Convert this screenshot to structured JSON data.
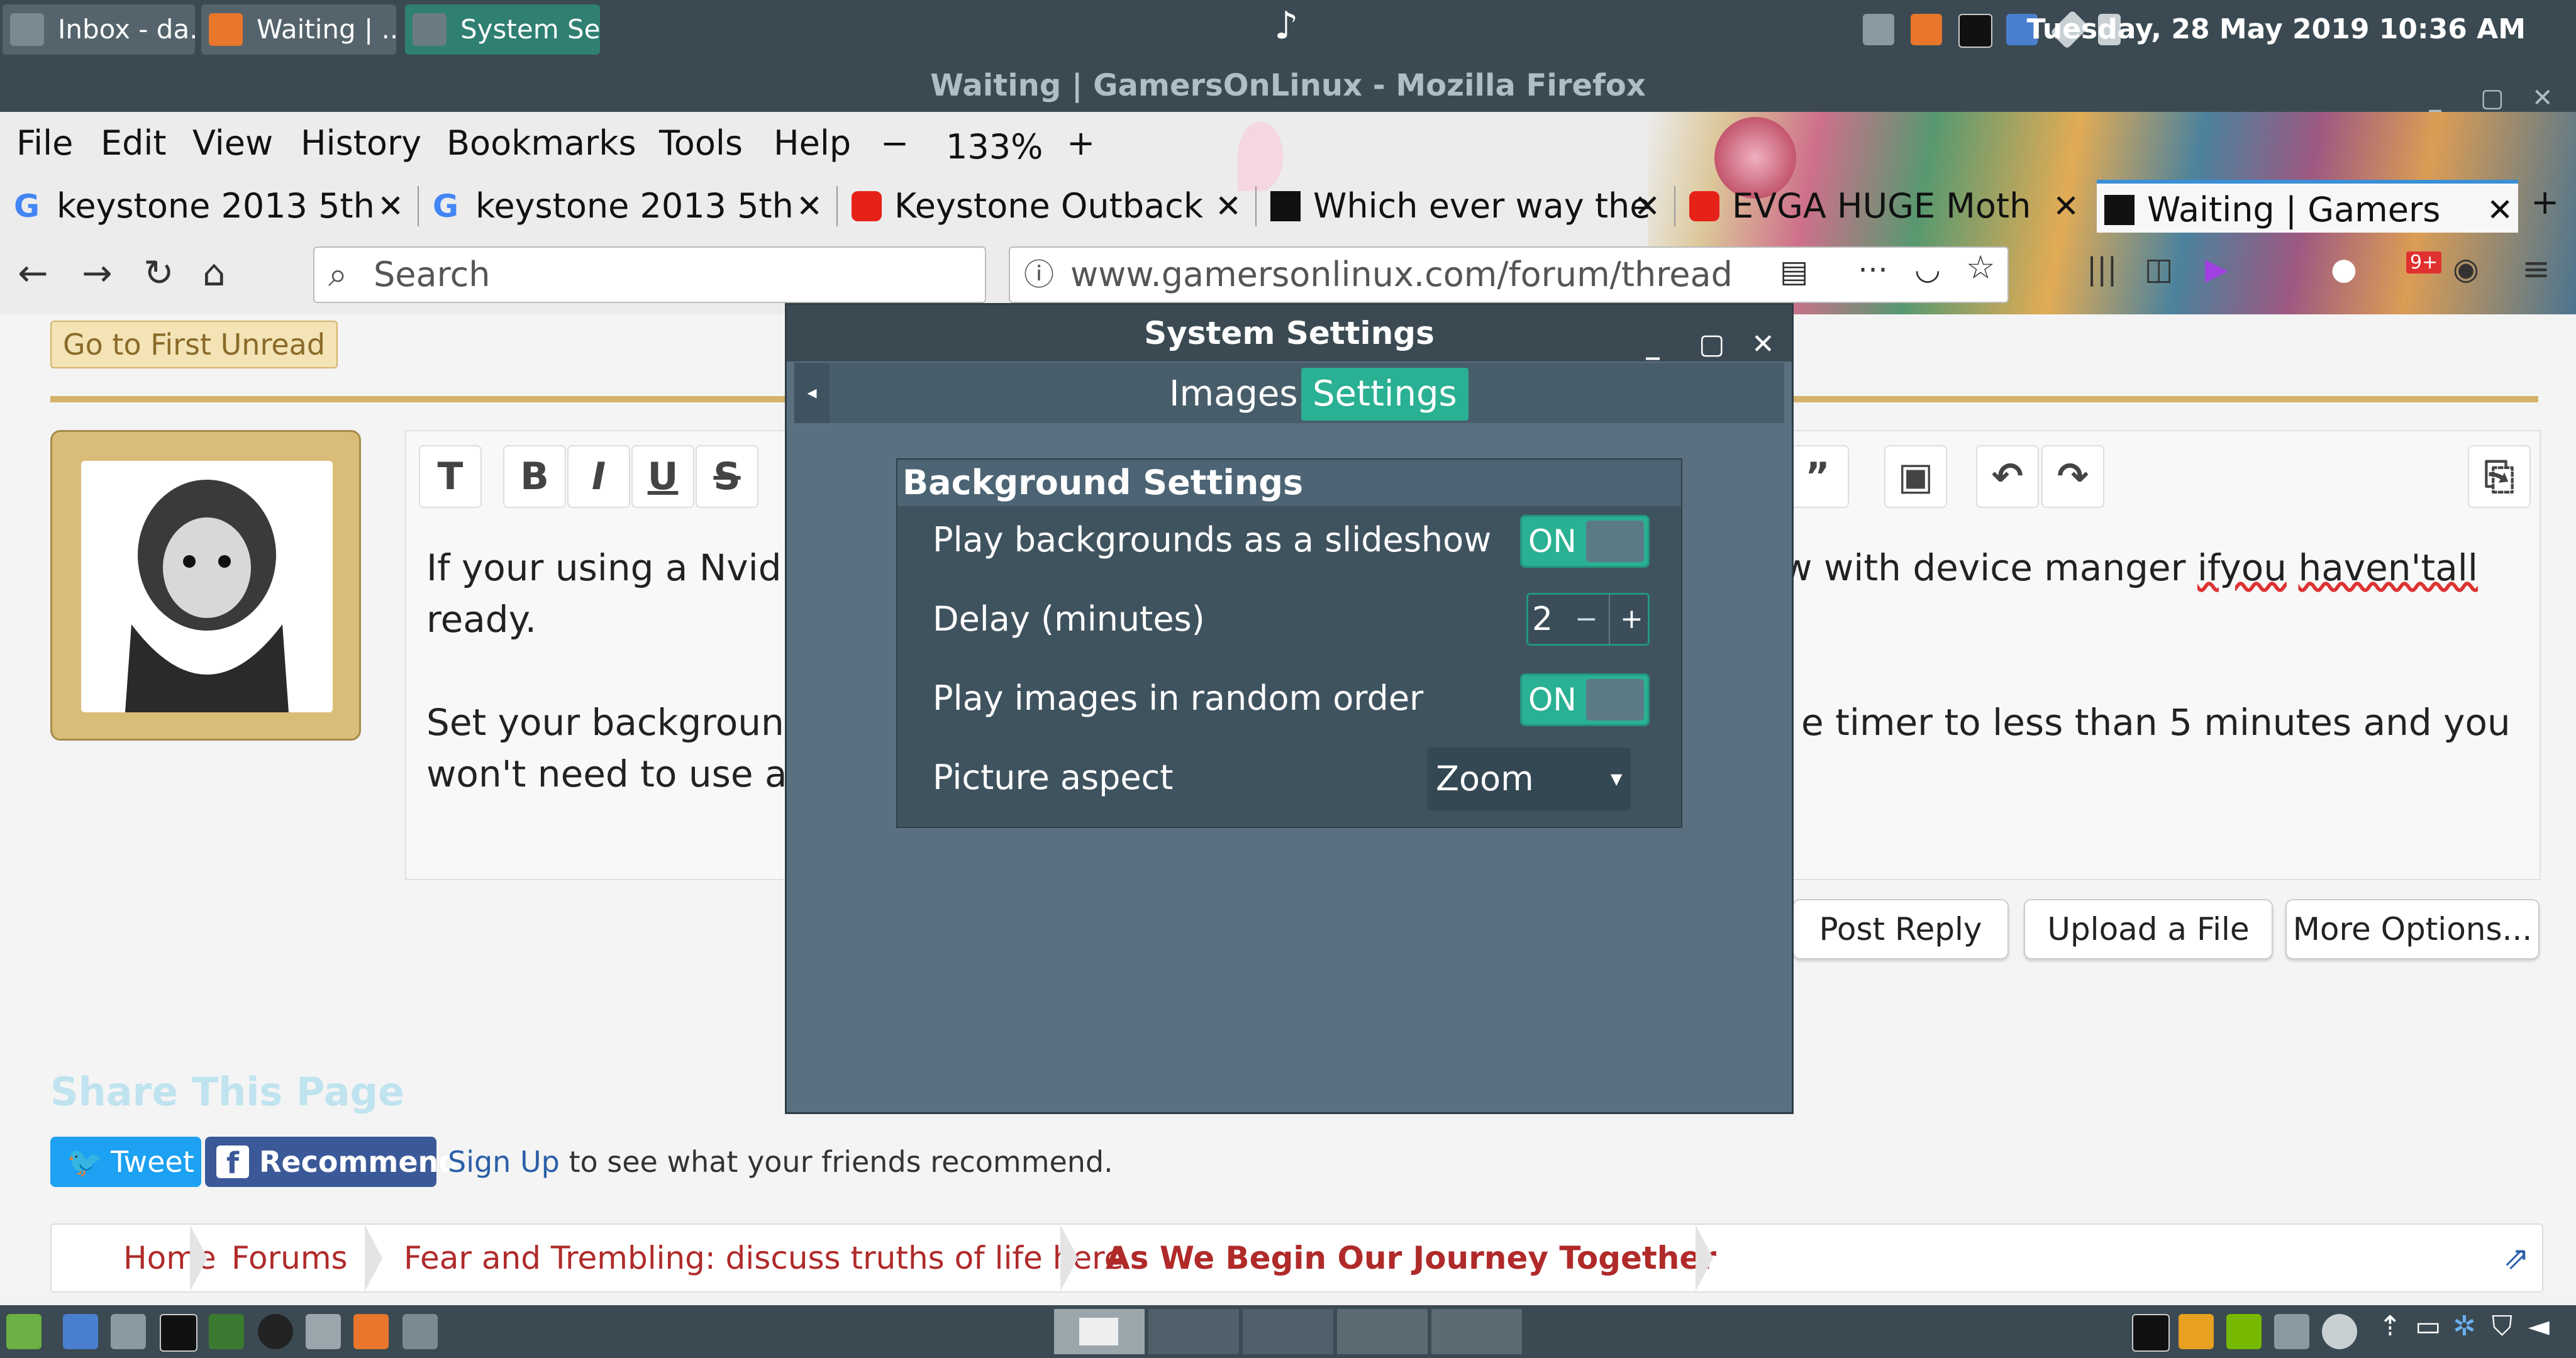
{
  "taskbar": {
    "tasks": [
      {
        "label": "Inbox - da..."
      },
      {
        "label": "Waiting | ..."
      },
      {
        "label": "System Se..."
      }
    ],
    "music_glyph": "♪",
    "clock": "Tuesday, 28 May 2019 10:36 AM"
  },
  "firefox": {
    "window_title": "Waiting | GamersOnLinux - Mozilla Firefox",
    "menu": [
      "File",
      "Edit",
      "View",
      "History",
      "Bookmarks",
      "Tools",
      "Help"
    ],
    "zoom": "133%",
    "tabs": [
      {
        "label": "keystone 2013 5th",
        "icon": "google-icon"
      },
      {
        "label": "keystone 2013 5th",
        "icon": "google-icon"
      },
      {
        "label": "Keystone Outback",
        "icon": "youtube-icon"
      },
      {
        "label": "Which ever way the",
        "icon": "gol-icon"
      },
      {
        "label": "EVGA HUGE Moth",
        "icon": "youtube-icon"
      },
      {
        "label": "Waiting | Gamers",
        "icon": "gol-icon"
      }
    ],
    "search_placeholder": "Search",
    "url": "www.gamersonlinux.com/forum/thread",
    "badge": "9+"
  },
  "page": {
    "first_unread": "Go to First Unread",
    "post_line1_left": "If your using a Nvid",
    "post_line1_right_a": "w with device manger ",
    "post_line1_right_b": "ifyou",
    "post_line1_right_c": " ",
    "post_line1_right_d": "haven'tall",
    "post_line2": "ready.",
    "post_line3_left": "Set your backgroun",
    "post_line3_right": "e timer to less than 5 minutes and you",
    "post_line4": "won't need to use a",
    "buttons": {
      "post_reply": "Post Reply",
      "upload": "Upload a File",
      "more": "More Options..."
    },
    "share_title": "Share This Page",
    "tweet": "Tweet",
    "recommend": "Recommend",
    "signup": "Sign Up",
    "signup_rest": " to see what your friends recommend.",
    "breadcrumb": [
      "Home",
      "Forums",
      "Fear and Trembling: discuss truths of life here",
      "As We Begin Our Journey Together"
    ]
  },
  "dialog": {
    "title": "System Settings",
    "tabs": [
      "Images",
      "Settings"
    ],
    "active_tab": "Settings",
    "section_title": "Background Settings",
    "rows": [
      {
        "label": "Play backgrounds as a slideshow",
        "value": "ON"
      },
      {
        "label": "Delay (minutes)",
        "value": "2"
      },
      {
        "label": "Play images in random order",
        "value": "ON"
      },
      {
        "label": "Picture aspect",
        "value": "Zoom"
      }
    ],
    "spin_minus": "−",
    "spin_plus": "+"
  },
  "colors": {
    "accent": "#2ab093",
    "panel": "#3b4a52",
    "link": "#2a5fa8",
    "crumb": "#b02a2a"
  }
}
